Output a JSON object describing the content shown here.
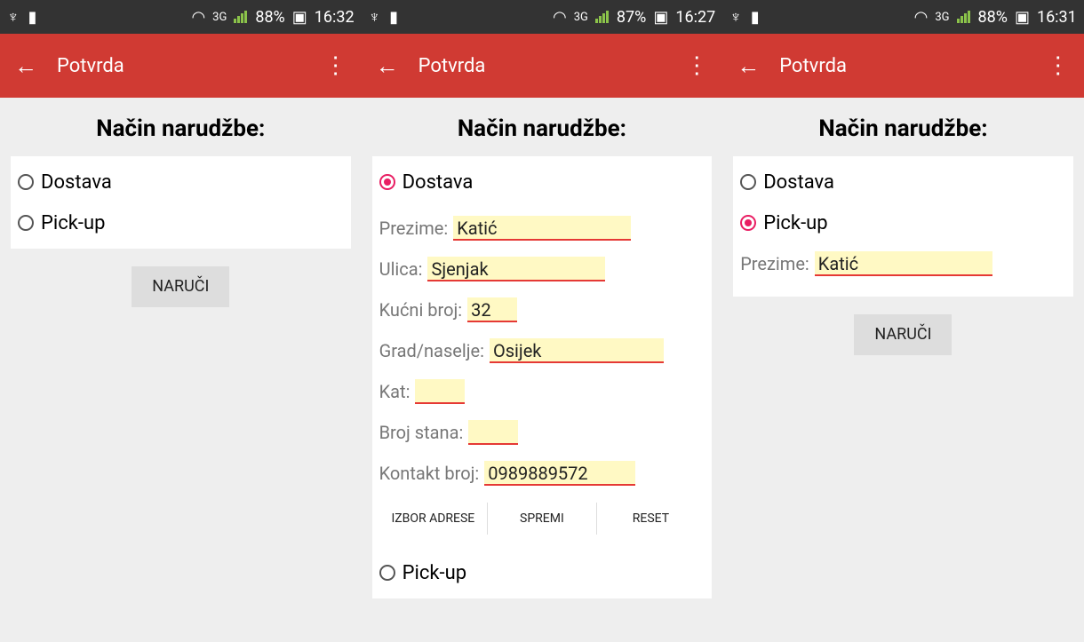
{
  "status_bars": [
    {
      "battery": "88%",
      "time": "16:32",
      "net": "3G"
    },
    {
      "battery": "87%",
      "time": "16:27",
      "net": "3G"
    },
    {
      "battery": "88%",
      "time": "16:31",
      "net": "3G"
    }
  ],
  "appbar": {
    "title": "Potvrda"
  },
  "screens": {
    "left": {
      "heading": "Način narudžbe:",
      "radio_dostava": "Dostava",
      "radio_pickup": "Pick-up",
      "submit": "NARUČI"
    },
    "middle": {
      "heading": "Način narudžbe:",
      "radio_dostava": "Dostava",
      "fields": {
        "prezime_label": "Prezime:",
        "prezime_value": "Katić",
        "ulica_label": "Ulica:",
        "ulica_value": "Sjenjak",
        "kucni_label": "Kućni broj:",
        "kucni_value": "32",
        "grad_label": "Grad/naselje:",
        "grad_value": "Osijek",
        "kat_label": "Kat:",
        "kat_value": "",
        "stan_label": "Broj stana:",
        "stan_value": "",
        "kontakt_label": "Kontakt broj:",
        "kontakt_value": "0989889572"
      },
      "buttons": {
        "izbor": "IZBOR ADRESE",
        "spremi": "SPREMI",
        "reset": "RESET"
      },
      "radio_pickup": "Pick-up"
    },
    "right": {
      "heading": "Način narudžbe:",
      "radio_dostava": "Dostava",
      "radio_pickup": "Pick-up",
      "prezime_label": "Prezime:",
      "prezime_value": "Katić",
      "submit": "NARUČI"
    }
  }
}
